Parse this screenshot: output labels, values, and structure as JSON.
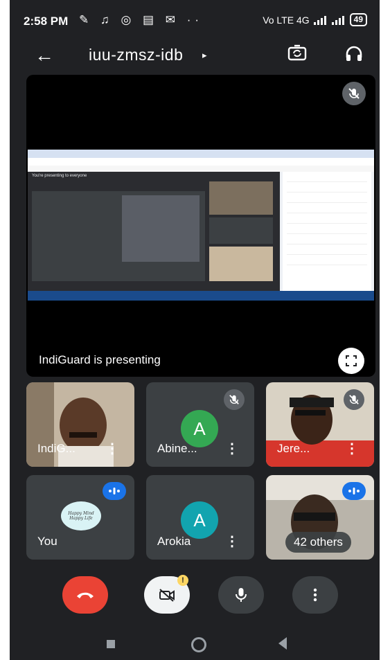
{
  "status_bar": {
    "time": "2:58 PM",
    "notification_icons": "✎ ♫ ◎ ▤ ✉ ··",
    "network": "Vo LTE 4G",
    "battery": "49"
  },
  "header": {
    "meeting_code": "iuu-zmsz-idb",
    "caret": "▸"
  },
  "presentation": {
    "presenter_label": "IndiGuard is presenting",
    "screen_banner": "You're presenting to everyone"
  },
  "participants": [
    {
      "name": "IndiG...",
      "mic_muted": false
    },
    {
      "name": "Abine...",
      "avatar_letter": "A",
      "avatar_color": "#34a853",
      "mic_muted": true
    },
    {
      "name": "Jere...",
      "mic_muted": true
    },
    {
      "name": "You",
      "avatar_text_1": "Happy Mind",
      "avatar_text_2": "Happy Life",
      "speaking": true
    },
    {
      "name": "Arokia",
      "avatar_letter": "A",
      "avatar_color": "#12a4af"
    },
    {
      "name": "42 others",
      "speaking": true
    }
  ],
  "controls": {
    "video_badge": "!",
    "end_call_color": "#ea4335"
  },
  "colors": {
    "background": "#202124",
    "tile": "#3c4043",
    "accent_blue": "#1a73e8"
  }
}
